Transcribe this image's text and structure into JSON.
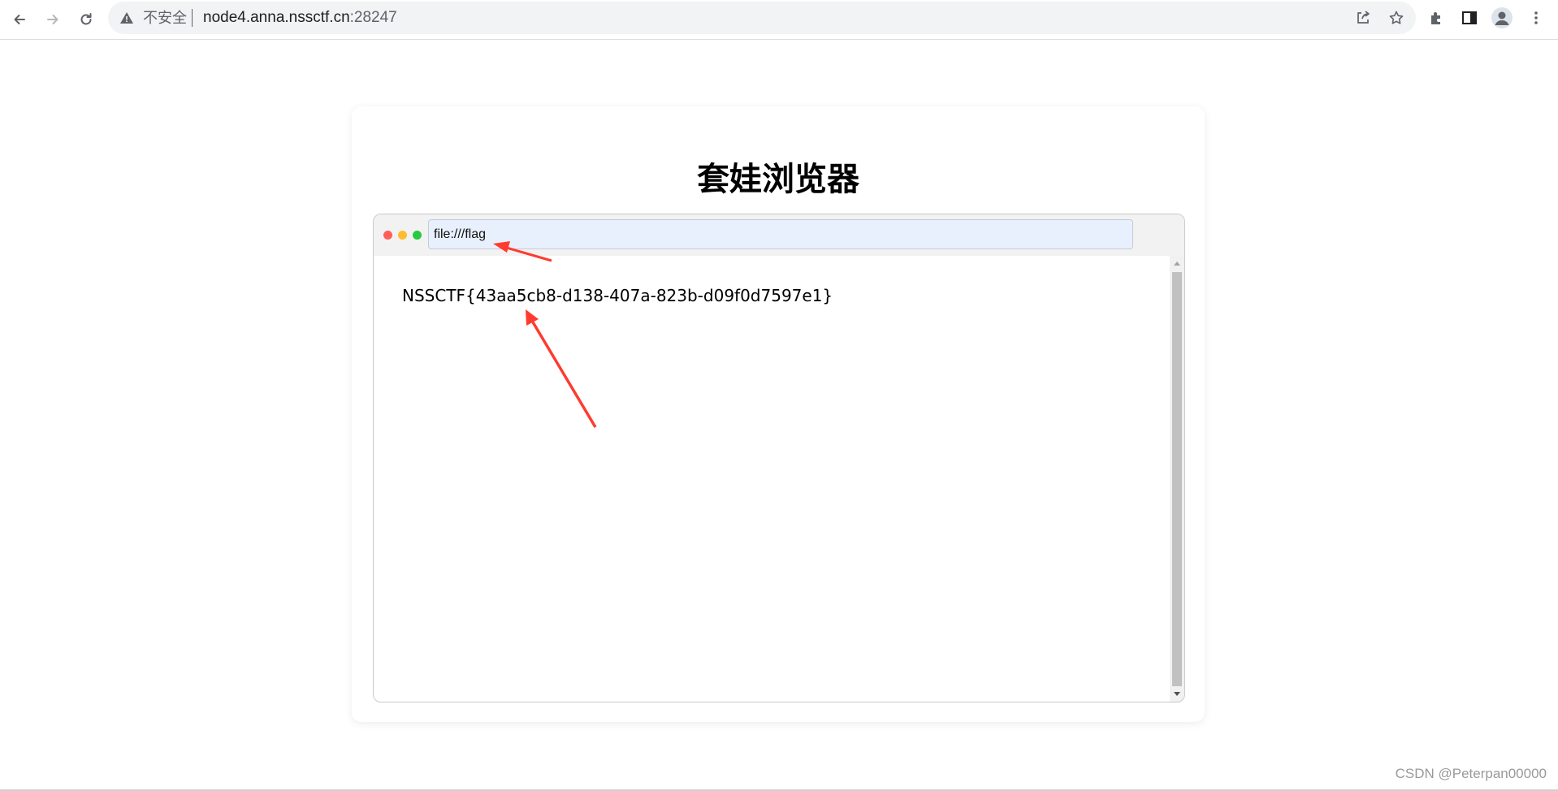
{
  "browser": {
    "security_label": "不安全",
    "url_host": "node4.anna.nssctf.cn",
    "url_port": ":28247",
    "icons": [
      "back-icon",
      "forward-icon",
      "reload-icon",
      "warning-icon",
      "share-icon",
      "star-icon",
      "extensions-icon",
      "side-panel-icon",
      "profile-icon",
      "menu-icon"
    ]
  },
  "page": {
    "title": "套娃浏览器",
    "inner_browser": {
      "url_value": "file:///flag",
      "content_text": "NSSCTF{43aa5cb8-d138-407a-823b-d09f0d7597e1}",
      "dot_colors": [
        "#ff5f57",
        "#febc2e",
        "#28c840"
      ]
    }
  },
  "watermark": "CSDN @Peterpan00000",
  "colors": {
    "annotation_arrow": "#ff3b30",
    "omnibox_bg": "#f1f3f4"
  }
}
